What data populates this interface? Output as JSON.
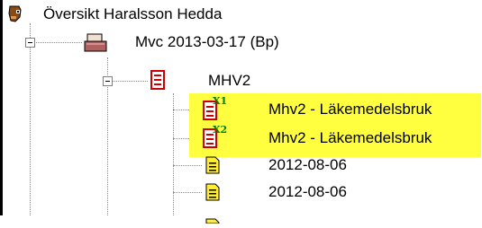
{
  "tree": {
    "root": {
      "label": "Översikt Haralsson Hedda",
      "icon": "patient-icon"
    },
    "visit": {
      "label": "Mvc 2013-03-17 (Bp)",
      "icon": "folder-icon"
    },
    "form": {
      "label": "MHV2",
      "icon": "form-icon"
    },
    "documents": [
      {
        "label": "Mhv2 - Läkemedelsbruk",
        "badge": "X1",
        "icon": "red-document-icon",
        "highlighted": true
      },
      {
        "label": "Mhv2 - Läkemedelsbruk",
        "badge": "X2",
        "icon": "red-document-icon",
        "highlighted": true
      },
      {
        "label": "2012-08-06",
        "icon": "document-icon",
        "highlighted": false
      },
      {
        "label": "2012-08-06",
        "icon": "document-icon",
        "highlighted": false
      }
    ]
  },
  "colors": {
    "highlight": "#ffff40",
    "badge": "#008000",
    "document_red": "#cc0000",
    "document_yellow": "#ffee33"
  }
}
